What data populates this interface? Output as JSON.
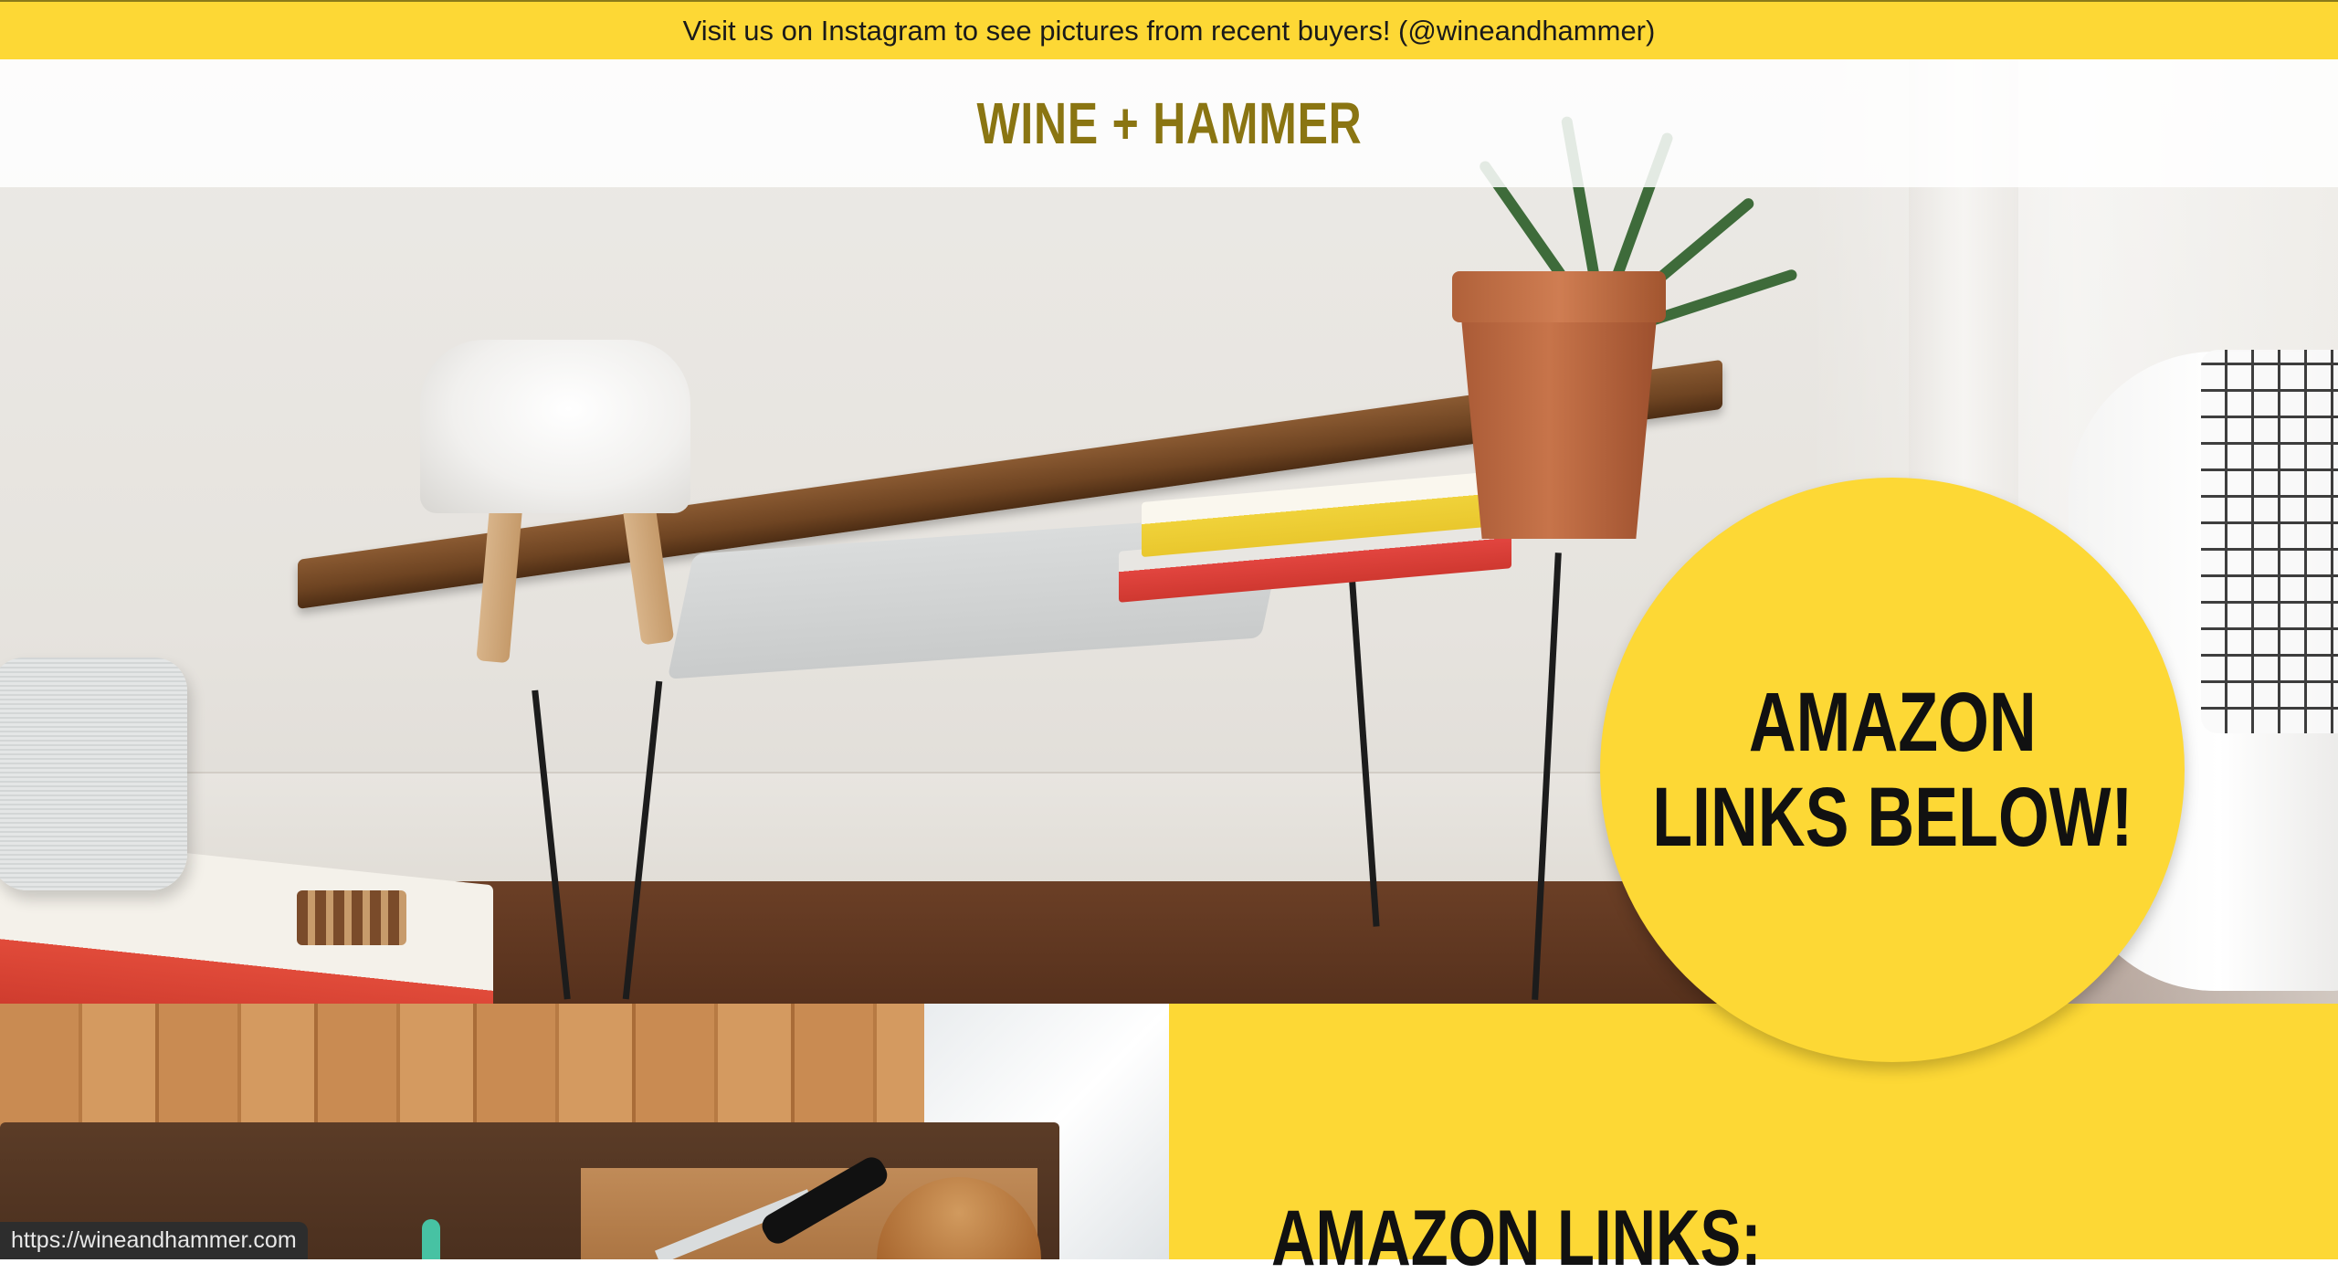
{
  "announcement": {
    "text": "Visit us on Instagram to see pictures from recent buyers! (@wineandhammer)"
  },
  "header": {
    "site_title": "WINE + HAMMER"
  },
  "hero": {
    "image_subject": "wooden bench with hairpin legs, lamp, plant, books",
    "badge": {
      "line1": "AMAZON",
      "line2": "LINKS BELOW!"
    }
  },
  "lower_section": {
    "heading": "AMAZON LINKS:"
  },
  "status_bar": {
    "url": "https://wineandhammer.com"
  },
  "colors": {
    "accent_yellow": "#fdd835",
    "title_olive": "#8a7512",
    "text_dark": "#111111"
  }
}
